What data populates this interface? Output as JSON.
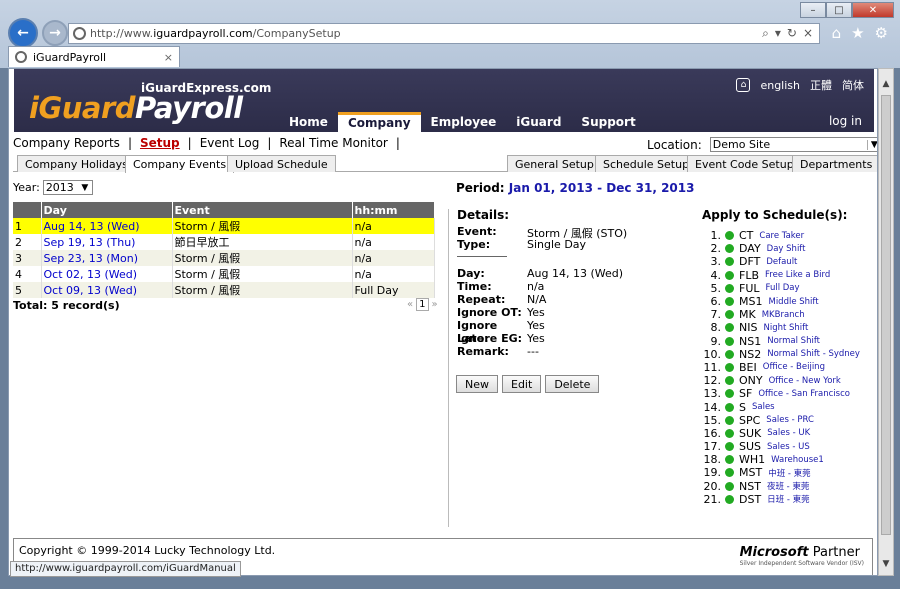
{
  "browser": {
    "url_prefix": "http://www.",
    "url_domain": "iguardpayroll.com",
    "url_path": "/CompanySetup",
    "tab_title": "iGuardPayroll",
    "tab_close": "×",
    "status_url": "http://www.iguardpayroll.com/iGuardManual"
  },
  "banner": {
    "sub_logo": "iGuardExpress.com",
    "logo_i": "iGuard",
    "logo_p": "Payroll",
    "langs": [
      "english",
      "正體",
      "简体"
    ],
    "nav": [
      "Home",
      "Company",
      "Employee",
      "iGuard",
      "Support"
    ],
    "login": "log in"
  },
  "subnav": {
    "items": [
      "Company Reports",
      "Setup",
      "Event Log",
      "Real Time Monitor"
    ],
    "sep": "|",
    "location_label": "Location:",
    "location_value": "Demo Site"
  },
  "tabs": {
    "left": [
      "Company Holidays",
      "Company Events",
      "Upload Schedule"
    ],
    "right": [
      "General Setup",
      "Schedule Setup",
      "Event Code Setup",
      "Departments"
    ]
  },
  "year": {
    "label": "Year:",
    "value": "2013"
  },
  "table": {
    "headers": [
      "",
      "Day",
      "Event",
      "hh:mm"
    ],
    "rows": [
      {
        "n": "1",
        "day": "Aug 14, 13 (Wed)",
        "event": "Storm / 風假",
        "hhmm": "n/a"
      },
      {
        "n": "2",
        "day": "Sep 19, 13 (Thu)",
        "event": "節日早放工",
        "hhmm": "n/a"
      },
      {
        "n": "3",
        "day": "Sep 23, 13 (Mon)",
        "event": "Storm / 風假",
        "hhmm": "n/a"
      },
      {
        "n": "4",
        "day": "Oct 02, 13 (Wed)",
        "event": "Storm / 風假",
        "hhmm": "n/a"
      },
      {
        "n": "5",
        "day": "Oct 09, 13 (Wed)",
        "event": "Storm / 風假",
        "hhmm": "Full Day"
      }
    ],
    "total": "Total: 5 record(s)",
    "pager": {
      "prev": "«",
      "current": "1",
      "next": "»"
    }
  },
  "period": {
    "label": "Period:",
    "value": "Jan 01, 2013 - Dec 31, 2013"
  },
  "details": {
    "heading": "Details:",
    "event_label": "Event:",
    "event_value": "Storm / 風假 (STO)",
    "type_label": "Type:",
    "type_value": "Single Day",
    "day_label": "Day:",
    "day_value": "Aug 14, 13 (Wed)",
    "time_label": "Time:",
    "time_value": "n/a",
    "repeat_label": "Repeat:",
    "repeat_value": "N/A",
    "ignore_ot_label": "Ignore OT:",
    "ignore_ot_value": "Yes",
    "ignore_late_label": "Ignore Late:",
    "ignore_late_value": "Yes",
    "ignore_eg_label": "Ignore EG:",
    "ignore_eg_value": "Yes",
    "remark_label": "Remark:",
    "remark_value": "---",
    "buttons": [
      "New",
      "Edit",
      "Delete"
    ]
  },
  "apply": {
    "heading": "Apply to Schedule(s):",
    "items": [
      {
        "n": "1.",
        "code": "CT",
        "name": "Care Taker"
      },
      {
        "n": "2.",
        "code": "DAY",
        "name": "Day Shift"
      },
      {
        "n": "3.",
        "code": "DFT",
        "name": "Default"
      },
      {
        "n": "4.",
        "code": "FLB",
        "name": "Free Like a Bird"
      },
      {
        "n": "5.",
        "code": "FUL",
        "name": "Full Day"
      },
      {
        "n": "6.",
        "code": "MS1",
        "name": "Middle Shift"
      },
      {
        "n": "7.",
        "code": "MK",
        "name": "MKBranch"
      },
      {
        "n": "8.",
        "code": "NIS",
        "name": "Night Shift"
      },
      {
        "n": "9.",
        "code": "NS1",
        "name": "Normal Shift"
      },
      {
        "n": "10.",
        "code": "NS2",
        "name": "Normal Shift - Sydney"
      },
      {
        "n": "11.",
        "code": "BEI",
        "name": "Office - Beijing"
      },
      {
        "n": "12.",
        "code": "ONY",
        "name": "Office - New York"
      },
      {
        "n": "13.",
        "code": "SF",
        "name": "Office - San Francisco"
      },
      {
        "n": "14.",
        "code": "S",
        "name": "Sales"
      },
      {
        "n": "15.",
        "code": "SPC",
        "name": "Sales - PRC"
      },
      {
        "n": "16.",
        "code": "SUK",
        "name": "Sales - UK"
      },
      {
        "n": "17.",
        "code": "SUS",
        "name": "Sales - US"
      },
      {
        "n": "18.",
        "code": "WH1",
        "name": "Warehouse1"
      },
      {
        "n": "19.",
        "code": "MST",
        "name": "中班 - 東莞"
      },
      {
        "n": "20.",
        "code": "NST",
        "name": "夜班 - 東莞"
      },
      {
        "n": "21.",
        "code": "DST",
        "name": "日班 - 東莞"
      }
    ]
  },
  "footer": {
    "copyright": "Copyright © 1999-2014 Lucky Technology Ltd.",
    "ms_m": "Microsoft",
    "ms_p": "Partner",
    "ms_sub": "Silver Independent Software Vendor (ISV)"
  },
  "colors": {
    "accent": "#f0a020",
    "banner": "#2c2c48",
    "selected_row": "#ffff00",
    "status_dot": "#22aa22",
    "link": "#1a1aaa"
  },
  "icons": [
    "back-arrow-icon",
    "forward-arrow-icon",
    "home-icon",
    "star-icon",
    "gear-icon",
    "refresh-icon",
    "search-icon"
  ]
}
